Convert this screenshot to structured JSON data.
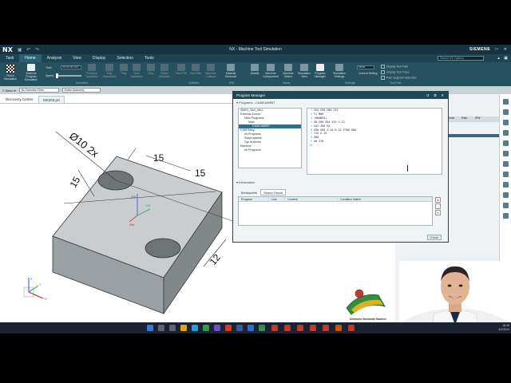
{
  "window": {
    "app_logo": "NX",
    "quick_access": "▣ ↶ ↷",
    "title": "NX - Machine Tool Simulation",
    "brand": "SIEMENS",
    "controls": "— □ ✕"
  },
  "menu": {
    "items": [
      "Task",
      "Home",
      "Analysis",
      "View",
      "Display",
      "Selection",
      "Tools"
    ],
    "active": "Home",
    "search_placeholder": "Search NX Options"
  },
  "ribbon": {
    "finish_label": "Finish Simulation",
    "external_label": "External Program Simulation",
    "time_label": "Time",
    "time_value": "00:00:00.000",
    "speed_label": "Speed",
    "animation_label": "Animation",
    "buttons": [
      {
        "label": "Previous Operation"
      },
      {
        "label": "Play Backward"
      },
      {
        "label": "Play"
      },
      {
        "label": "Next Operation"
      },
      {
        "label": "Stop"
      },
      {
        "label": "Reset Machine"
      },
      {
        "label": "Tool IPW"
      },
      {
        "label": "Tool Path"
      },
      {
        "label": "Machine Collision"
      },
      {
        "label": "Material Removal"
      },
      {
        "label": "Details"
      },
      {
        "label": "Machine Components"
      },
      {
        "label": "Machine Status"
      },
      {
        "label": "Simulation View"
      },
      {
        "label": "Program Manager"
      },
      {
        "label": "Simulation Settings"
      },
      {
        "label": "Current Setting"
      }
    ],
    "group_labels": [
      "Collision",
      "IPW",
      "Views",
      "Settings",
      "Tool Path"
    ],
    "current_setting": "None",
    "toolpath_options": [
      "Display Tool Path",
      "Display Tool Trace",
      "Path Segment Selection"
    ]
  },
  "toolbar2": {
    "menu_label": "≡ Menu ▾",
    "filter": "No Selection Filter",
    "assembly": "Entire Assembly"
  },
  "tabs": [
    "Discovery Center",
    "MX203.prt"
  ],
  "right_dock": {
    "columns": [
      "Tools",
      "Path",
      "IPW"
    ]
  },
  "drawing": {
    "dim_hole": "Ø10 2x",
    "dim_top_a": "15",
    "dim_top_b": "15",
    "dim_left": "15",
    "dim_right": "12",
    "axis_z": "ZM",
    "axis_y": "YM",
    "axis_x": "XM",
    "triad_z": "Z",
    "triad_y": "Y",
    "triad_x": "X"
  },
  "dialog": {
    "title": "Program Manager",
    "controls": "↺ ⚙ ✕",
    "section_programs": "▾ Programs - CAMCAM997",
    "tree": [
      {
        "label": "SIM01_5AX_MILL",
        "depth": 0,
        "selected": false
      },
      {
        "label": "External Source",
        "depth": 0,
        "selected": false
      },
      {
        "label": "Main Programs",
        "depth": 1,
        "selected": false
      },
      {
        "label": "Main",
        "depth": 2,
        "selected": false
      },
      {
        "label": "CAMCAM997",
        "depth": 3,
        "selected": true
      },
      {
        "label": "CAM Setup",
        "depth": 0,
        "selected": false
      },
      {
        "label": "Int Programs",
        "depth": 1,
        "selected": false
      },
      {
        "label": "Subprograms",
        "depth": 1,
        "selected": false
      },
      {
        "label": "Cyc Archives",
        "depth": 1,
        "selected": false
      },
      {
        "label": "Machine",
        "depth": 0,
        "selected": false
      },
      {
        "label": "Int Programs",
        "depth": 1,
        "selected": false
      }
    ],
    "code": [
      {
        "n": "1",
        "text": "G54 G90 G00 G22"
      },
      {
        "n": "2",
        "text": "T1 M06"
      },
      {
        "n": "3",
        "text": "(DRAW93)"
      },
      {
        "n": "4",
        "text": "G0 G90 G54 X15 Y-12"
      },
      {
        "n": "5",
        "text": "G43 Z50 H1"
      },
      {
        "n": "6",
        "text": "G98 G83 Z-10 R-12 F300 R00"
      },
      {
        "n": "7",
        "text": "Y15 X-15"
      },
      {
        "n": "8",
        "text": "G80"
      },
      {
        "n": "9",
        "text": "G0 Z10"
      },
      {
        "n": "10",
        "text": ""
      }
    ],
    "section_info": "▾ Information",
    "subtabs": [
      "Breakpoints",
      "Search Result"
    ],
    "active_subtab": "Search Result",
    "grid_columns": [
      "Program",
      "Line",
      "Content",
      "Condition Match"
    ],
    "close_label": "Close"
  },
  "badge": {
    "text": "Deltaisms Worldwide Machine"
  },
  "taskbar": {
    "time": "18:45",
    "date": "4/2/2024"
  },
  "colors": {
    "title_bar": "#16343f",
    "ribbon": "#26515f",
    "dialog_header": "#1f4756",
    "tree_selection": "#2f6f8a",
    "part_top": "#c9cdcf",
    "part_front": "#9aa0a3"
  }
}
